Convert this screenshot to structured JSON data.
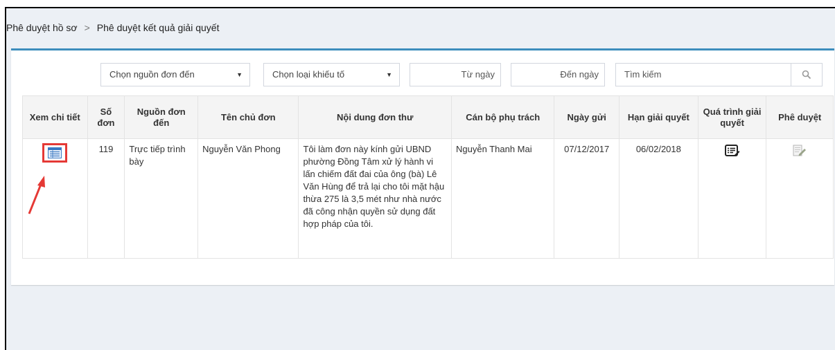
{
  "breadcrumb": {
    "item1": "Phê duyệt hồ sơ",
    "separator": ">",
    "item2": "Phê duyệt kết quả giải quyết"
  },
  "filters": {
    "source_select": "Chọn nguồn đơn đến",
    "type_select": "Chọn loại khiếu tố",
    "from_date": "Từ ngày",
    "to_date": "Đến ngày",
    "search_placeholder": "Tìm kiếm",
    "search_icon": "search-icon"
  },
  "table": {
    "headers": {
      "view": "Xem chi tiết",
      "number": "Số đơn",
      "source": "Nguồn đơn đến",
      "owner": "Tên chủ đơn",
      "content": "Nội dung đơn thư",
      "officer": "Cán bộ phụ trách",
      "sent_date": "Ngày gửi",
      "deadline": "Hạn giải quyết",
      "process": "Quá trình giải quyết",
      "approve": "Phê duyệt"
    },
    "rows": [
      {
        "number": "119",
        "source": "Trực tiếp trình bày",
        "owner": "Nguyễn Văn Phong",
        "content": "Tôi làm đơn này kính gửi UBND phường Đồng Tâm xử lý hành vi lấn chiếm đất đai của ông (bà) Lê Văn Hùng để trả lại cho tôi mặt hậu thừa 275 là 3,5 mét như nhà nước đã công nhận quyền sử dụng đất hợp pháp của tôi.",
        "officer": "Nguyễn Thanh Mai",
        "sent_date": "07/12/2017",
        "deadline": "06/02/2018"
      }
    ]
  },
  "colors": {
    "accent": "#3c8dbc",
    "highlight": "#e53935",
    "background": "#ecf0f5"
  }
}
